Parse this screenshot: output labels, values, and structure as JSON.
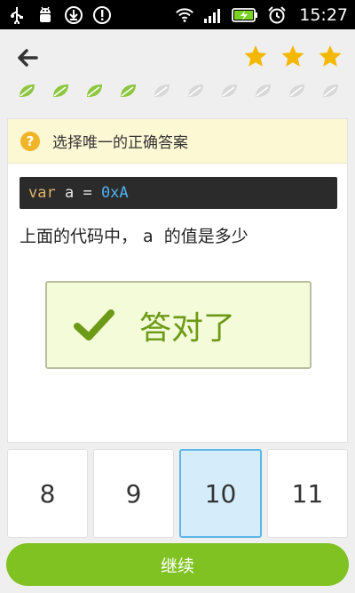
{
  "status_bar": {
    "time": "15:27",
    "left_icons": [
      "usb-icon",
      "android-debug-icon",
      "download-icon",
      "alert-icon"
    ],
    "right_icons": [
      "wifi-icon",
      "signal-icon",
      "battery-charging-icon",
      "alarm-icon"
    ]
  },
  "header": {
    "stars_count": 3,
    "star_color": "#f5b800",
    "progress": {
      "completed": 4,
      "total": 10,
      "done_color": "#8dc63f",
      "todo_color": "#d8d8d8"
    }
  },
  "instruction": {
    "text": "选择唯一的正确答案",
    "icon_label": "?"
  },
  "code": {
    "tokens": [
      {
        "text": "var",
        "kind": "keyword"
      },
      {
        "text": " a ",
        "kind": "identifier"
      },
      {
        "text": "=",
        "kind": "operator"
      },
      {
        "text": " ",
        "kind": "identifier"
      },
      {
        "text": "0xA",
        "kind": "number"
      }
    ]
  },
  "question": {
    "text": "上面的代码中， a  的值是多少"
  },
  "result": {
    "text": "答对了",
    "color": "#6d9a16"
  },
  "options": [
    {
      "label": "8",
      "selected": false
    },
    {
      "label": "9",
      "selected": false
    },
    {
      "label": "10",
      "selected": true
    },
    {
      "label": "11",
      "selected": false
    }
  ],
  "continue_button": {
    "label": "继续",
    "color": "#7fc221"
  }
}
